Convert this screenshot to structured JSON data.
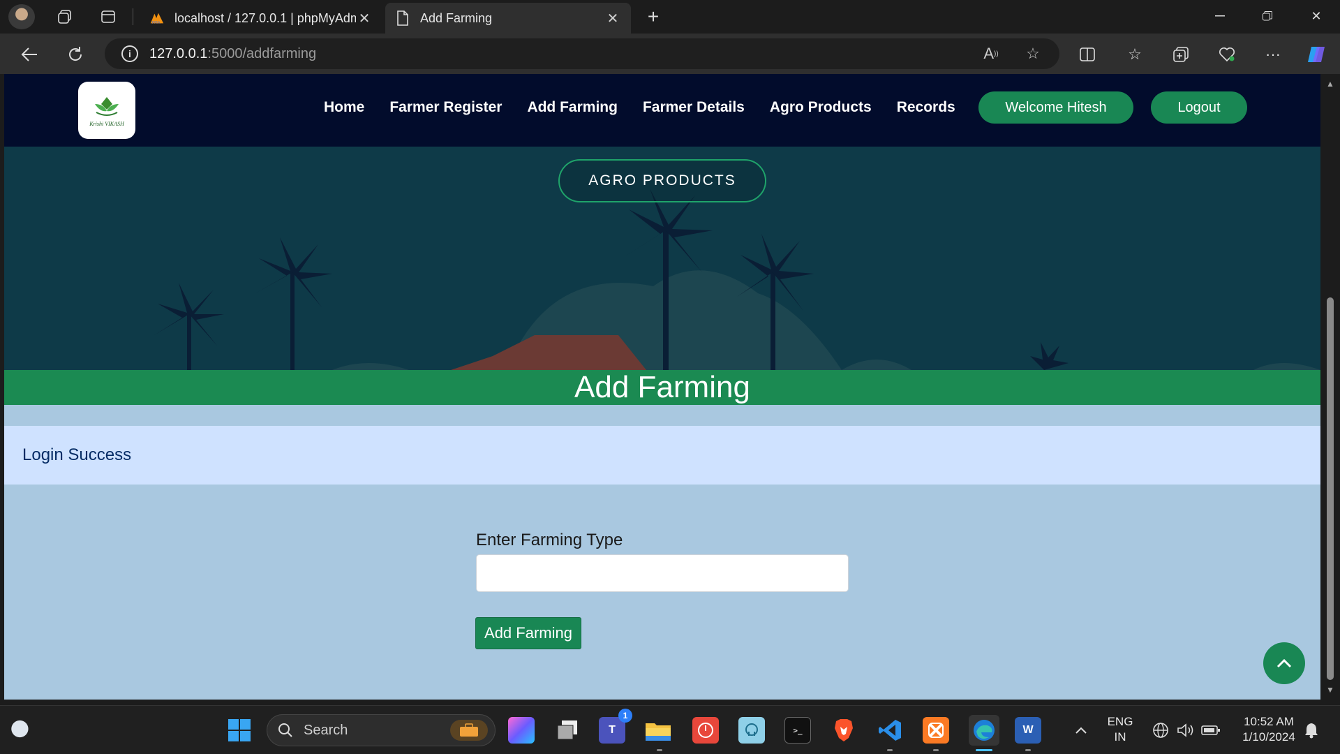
{
  "browser": {
    "tabs": [
      {
        "title": "localhost / 127.0.0.1 | phpMyAdmin",
        "active": false,
        "icon": "phpmyadmin-icon"
      },
      {
        "title": "Add Farming",
        "active": true,
        "icon": "document-icon"
      }
    ],
    "url_host": "127.0.0.1",
    "url_path": ":5000/addfarming"
  },
  "site": {
    "logo_text": "Krishi VIKASH",
    "nav": [
      "Home",
      "Farmer Register",
      "Add Farming",
      "Farmer Details",
      "Agro Products",
      "Records"
    ],
    "welcome": "Welcome Hitesh",
    "logout": "Logout",
    "hero_button": "AGRO PRODUCTS",
    "page_title": "Add Farming",
    "alert": "Login Success",
    "form": {
      "label": "Enter Farming Type",
      "value": "",
      "submit": "Add Farming"
    }
  },
  "taskbar": {
    "search_placeholder": "Search",
    "teams_badge": "1",
    "language": "ENG",
    "region": "IN",
    "time": "10:52 AM",
    "date": "1/10/2024"
  },
  "colors": {
    "navbar": "#020c2c",
    "accent_green": "#198754",
    "page_bg": "#a9c8e0",
    "alert_bg": "#cfe2ff"
  }
}
